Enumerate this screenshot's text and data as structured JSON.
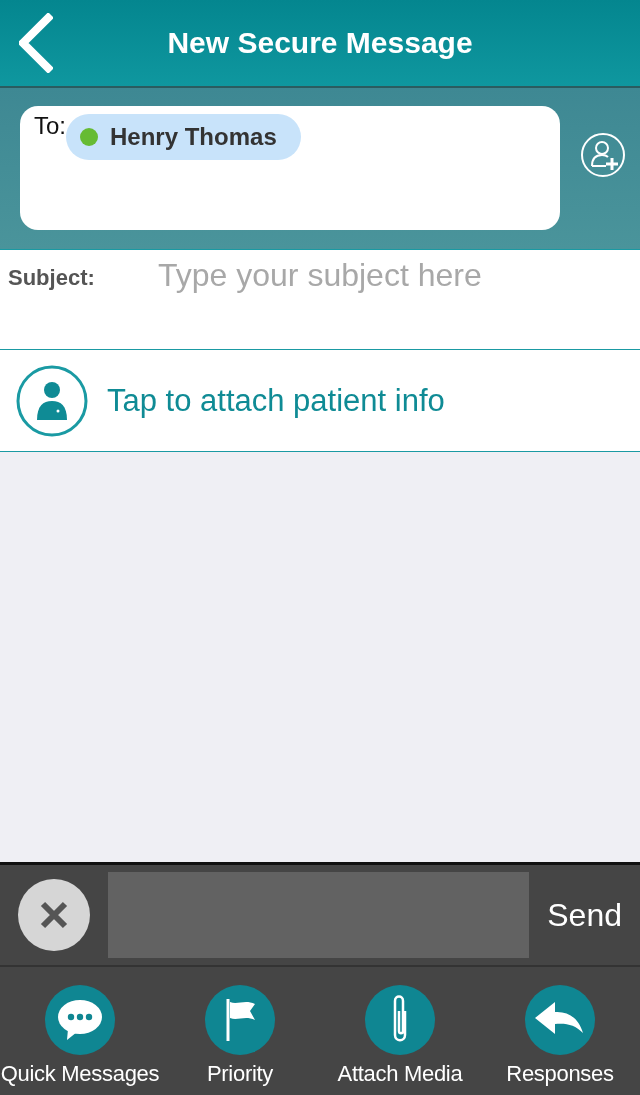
{
  "header": {
    "title": "New Secure Message"
  },
  "to": {
    "label": "To:",
    "recipients": [
      {
        "name": "Henry Thomas",
        "color": "#66bb33"
      }
    ]
  },
  "subject": {
    "label": "Subject:",
    "placeholder": "Type your subject here"
  },
  "patient": {
    "label": "Tap to attach patient info"
  },
  "compose": {
    "send": "Send"
  },
  "toolbar": [
    {
      "kind": "chat",
      "label": "Quick Messages"
    },
    {
      "kind": "flag",
      "label": "Priority"
    },
    {
      "kind": "clip",
      "label": "Attach Media"
    },
    {
      "kind": "reply",
      "label": "Responses"
    }
  ]
}
